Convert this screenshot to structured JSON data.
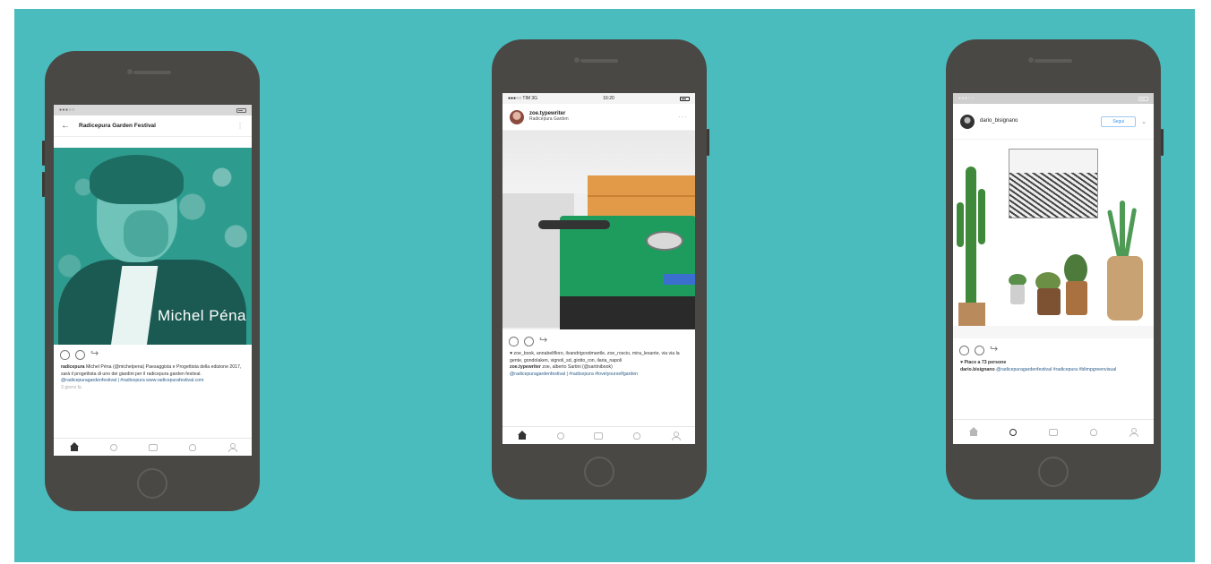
{
  "phones": [
    {
      "heading": "Radicepura Garden Festival",
      "photo_overlay_text": "Michel Péna",
      "caption": {
        "username": "radicepura",
        "text": "Michel Péna (@michelpena) Paesaggista e Progettista della edizione 2017, sarà il progettista di uno dei giardini per il radicepura garden festival.",
        "tags": "@radicepuragardenfestival | #radicepura www.radicepurafestival.com",
        "meta": "3 giorni fa"
      }
    },
    {
      "status_left": "●●●○○ TIM 3G",
      "status_time": "16:20",
      "username": "zoe.typewriter",
      "location": "Radicepura Garden",
      "likes_text": "♥ zoe_book, annabelifloro, ilvandrigoodmantle, zoe_roscio, mira_lesante, via via la gente, gondolaken, vignoli_sd, giotto_ron, ilaria_napoli",
      "caption_user": "zoe.typewriter",
      "caption_text": "zoe, alberto Sartini (@sartinibook)",
      "tags": "@radicepuragardenfestival | #radicepura #lovelyourselfgarden"
    },
    {
      "username": "dario_bisignano",
      "follow_label": "Segui",
      "likes_text": "♥ Piace a 73 persone",
      "caption_user": "dario.bisignano",
      "caption_text": "@radicepuragardenfestival #radicepura #blimpgreenvisual",
      "tags": ""
    }
  ],
  "icons": {
    "back": "back-arrow-icon",
    "more": "more-dots-icon",
    "heart": "heart-icon",
    "comment": "comment-icon",
    "share": "share-icon",
    "home": "home-icon",
    "search": "search-icon",
    "camera": "camera-icon",
    "activity": "heart-icon",
    "profile": "profile-icon"
  },
  "colors": {
    "background": "#4bbcbd",
    "phone_body": "#4a4845",
    "photo_teal": "#2e9b8f",
    "link_blue": "#2b5c8a"
  }
}
